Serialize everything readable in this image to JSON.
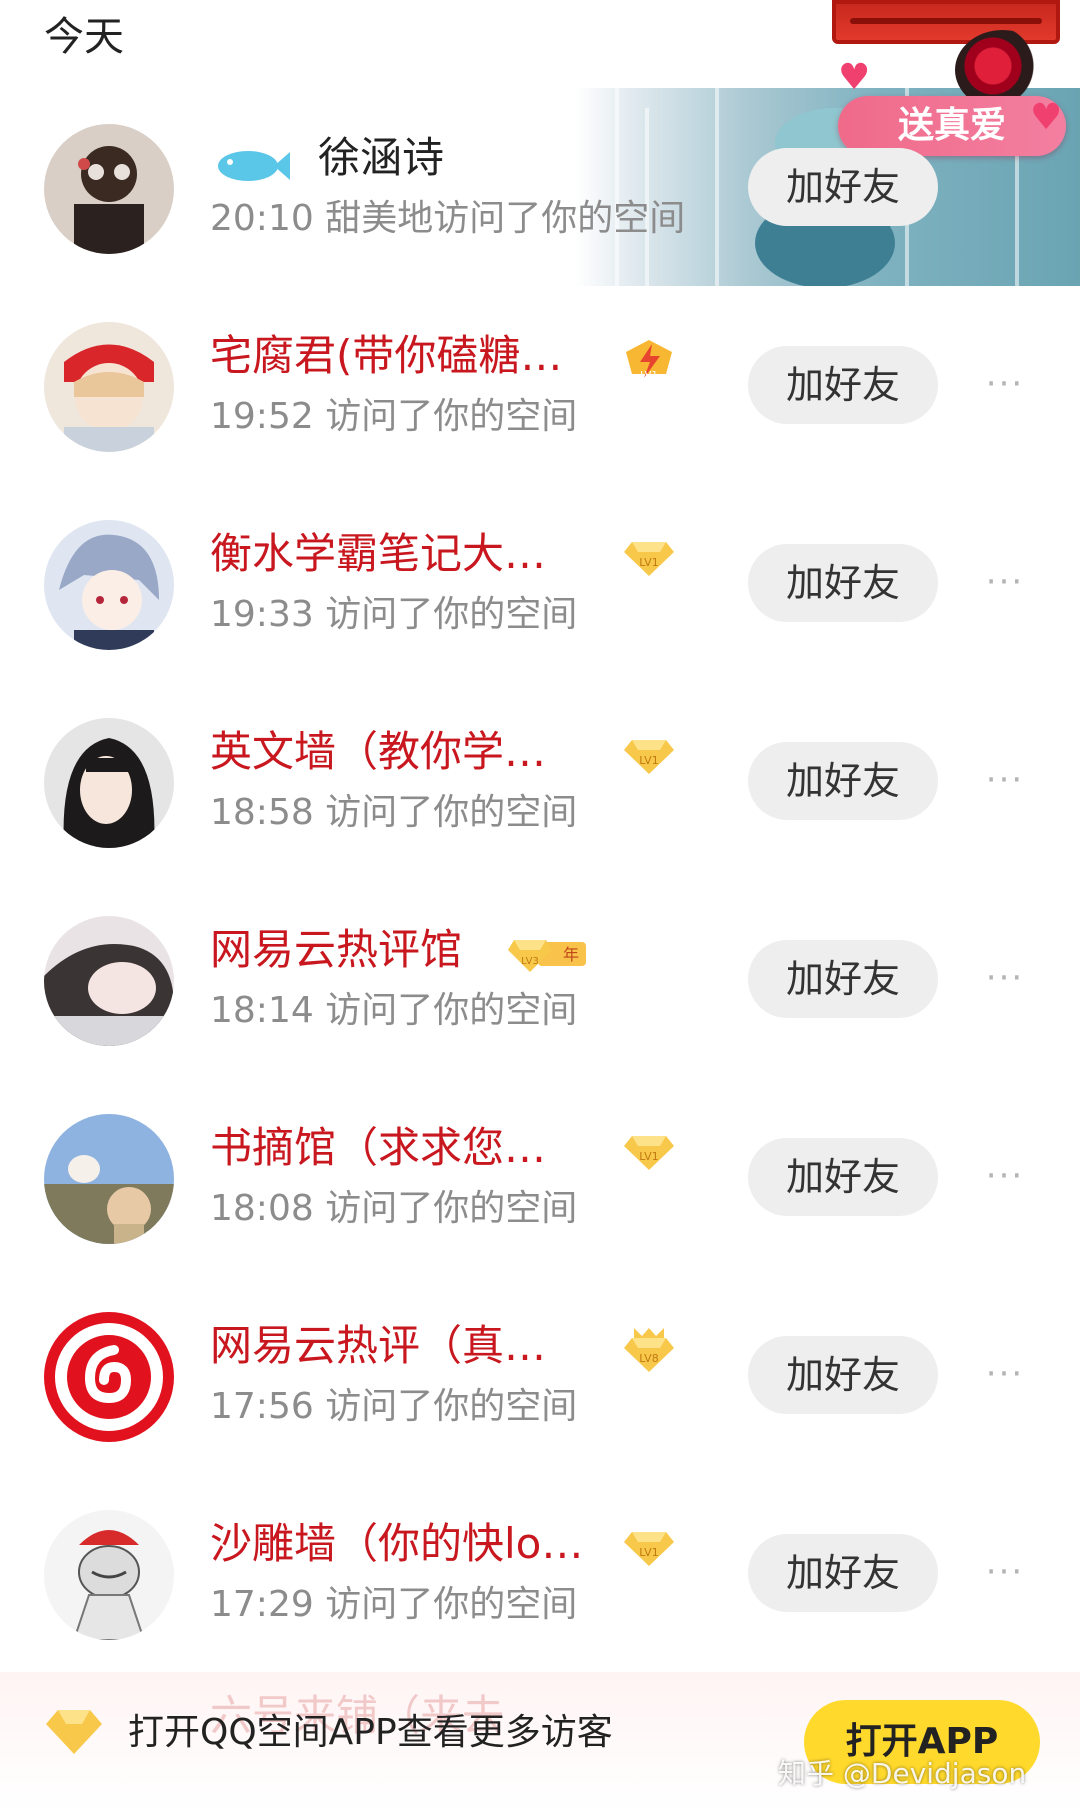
{
  "section_title": "今天",
  "banner": {
    "label": "送真爱"
  },
  "add_friend_label": "加好友",
  "more_label": "···",
  "visitors": [
    {
      "name": "徐涵诗",
      "time_text": "20:10 甜美地访问了你的空间",
      "badge": "none",
      "name_color": "black"
    },
    {
      "name": "宅腐君(带你磕糖…",
      "time_text": "19:52 访问了你的空间",
      "badge": "LV1"
    },
    {
      "name": "衡水学霸笔记大…",
      "time_text": "19:33 访问了你的空间",
      "badge": "LV1"
    },
    {
      "name": "英文墙（教你学…",
      "time_text": "18:58 访问了你的空间",
      "badge": "LV1"
    },
    {
      "name": "网易云热评馆",
      "time_text": "18:14 访问了你的空间",
      "badge": "LV3",
      "badge_extra": "年"
    },
    {
      "name": "书摘馆（求求您…",
      "time_text": "18:08 访问了你的空间",
      "badge": "LV1"
    },
    {
      "name": "网易云热评（真…",
      "time_text": "17:56 访问了你的空间",
      "badge": "LV8"
    },
    {
      "name": "沙雕墙（你的快lo…",
      "time_text": "17:29 访问了你的空间",
      "badge": "LV1"
    }
  ],
  "peek_name": "六号来铺（来去",
  "bottom": {
    "text": "打开QQ空间APP查看更多访客",
    "button": "打开APP"
  },
  "watermark": "知乎 @Devidjason",
  "colors": {
    "name_red": "#c8171e",
    "button_bg": "#eeeeef",
    "open_app": "#ffd92c"
  }
}
